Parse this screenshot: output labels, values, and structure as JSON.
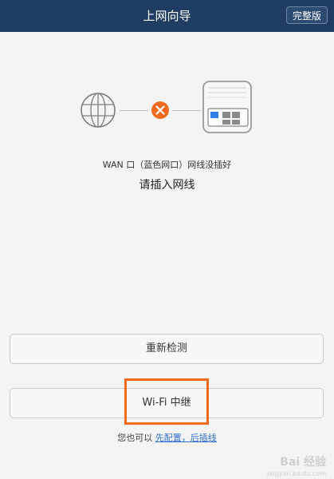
{
  "header": {
    "title": "上网向导",
    "full_button_label": "完整版"
  },
  "diagram": {
    "globe_icon": "globe-icon",
    "error_icon": "x-circle-icon",
    "router_icon": "router-icon",
    "error_color": "#ef6a1c",
    "port_active_color": "#2f80ed"
  },
  "status": {
    "message": "WAN 口（蓝色网口）网线没插好",
    "prompt": "请插入网线"
  },
  "actions": {
    "recheck_label": "重新检测",
    "relay_label": "Wi-Fi 中继"
  },
  "hint": {
    "prefix": "您也可以 ",
    "link": "先配置，后插线"
  },
  "watermark": {
    "text": "Bai 经验",
    "sub": "jingyan.baidu.com"
  }
}
